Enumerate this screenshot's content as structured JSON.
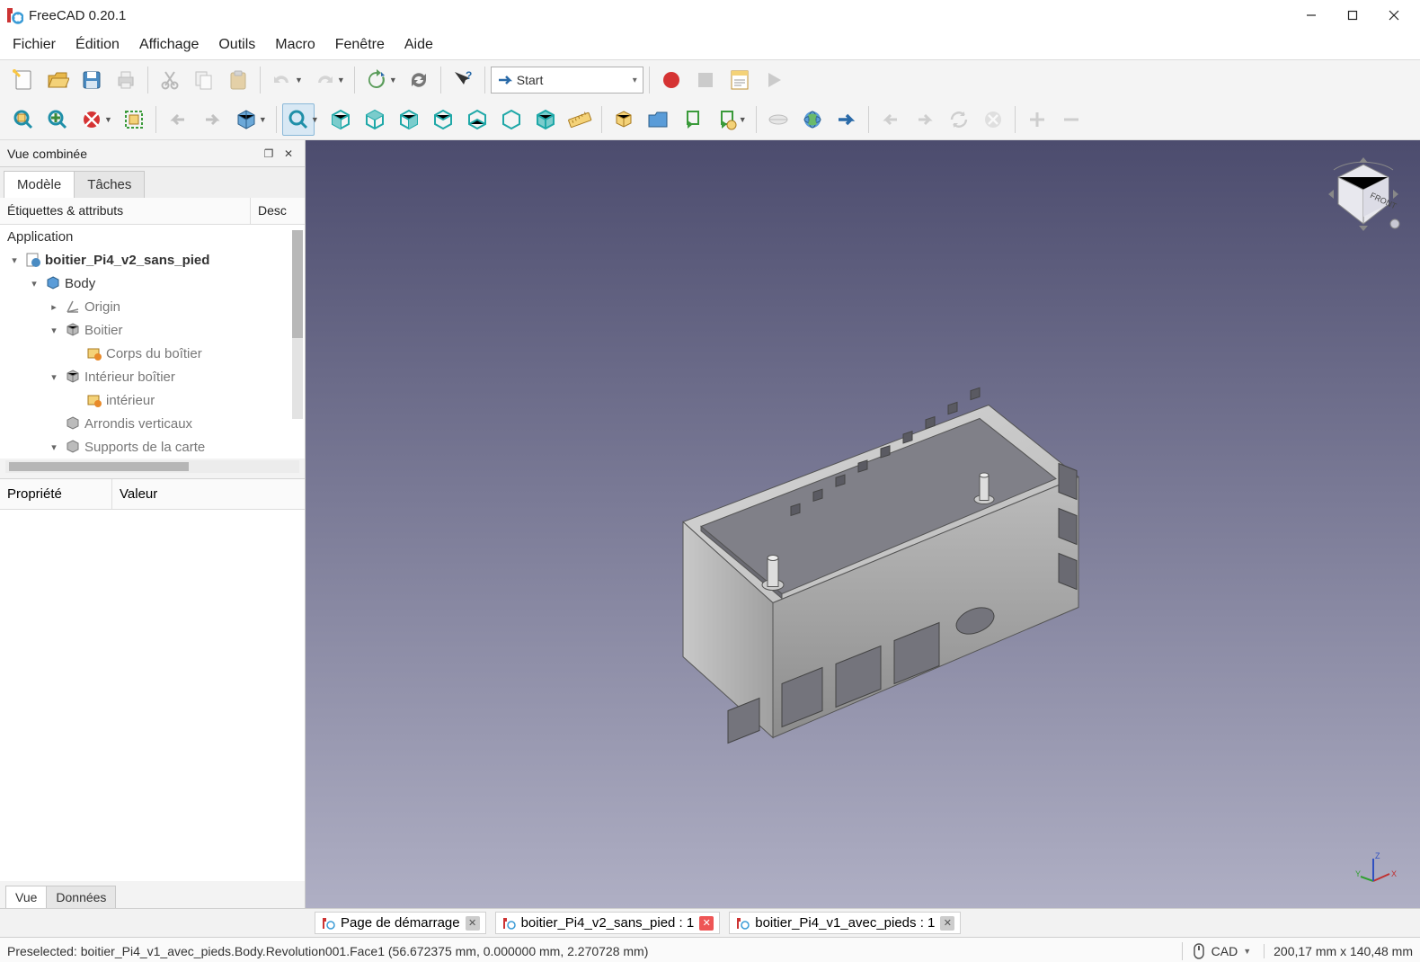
{
  "window": {
    "title": "FreeCAD 0.20.1"
  },
  "menu": {
    "file": "Fichier",
    "edit": "Édition",
    "view": "Affichage",
    "tools": "Outils",
    "macro": "Macro",
    "window": "Fenêtre",
    "help": "Aide"
  },
  "workbench": {
    "label": "Start"
  },
  "side": {
    "panel_title": "Vue combinée",
    "tab_model": "Modèle",
    "tab_tasks": "Tâches",
    "col_labels": "Étiquettes & attributs",
    "col_desc": "Desc",
    "app": "Application",
    "doc": "boitier_Pi4_v2_sans_pied",
    "body": "Body",
    "origin": "Origin",
    "g_boitier": "Boitier",
    "corps": "Corps du boîtier",
    "g_int": "Intérieur boîtier",
    "interieur": "intérieur",
    "arrondis": "Arrondis verticaux",
    "supports": "Supports de la carte",
    "prop": "Propriété",
    "val": "Valeur",
    "tab_view": "Vue",
    "tab_data": "Données"
  },
  "doctabs": {
    "start": "Page de démarrage",
    "d1": "boitier_Pi4_v2_sans_pied : 1",
    "d2": "boitier_Pi4_v1_avec_pieds : 1"
  },
  "status": {
    "msg": "Preselected: boitier_Pi4_v1_avec_pieds.Body.Revolution001.Face1 (56.672375 mm, 0.000000 mm, 2.270728 mm)",
    "navstyle": "CAD",
    "dims": "200,17 mm x 140,48 mm"
  }
}
